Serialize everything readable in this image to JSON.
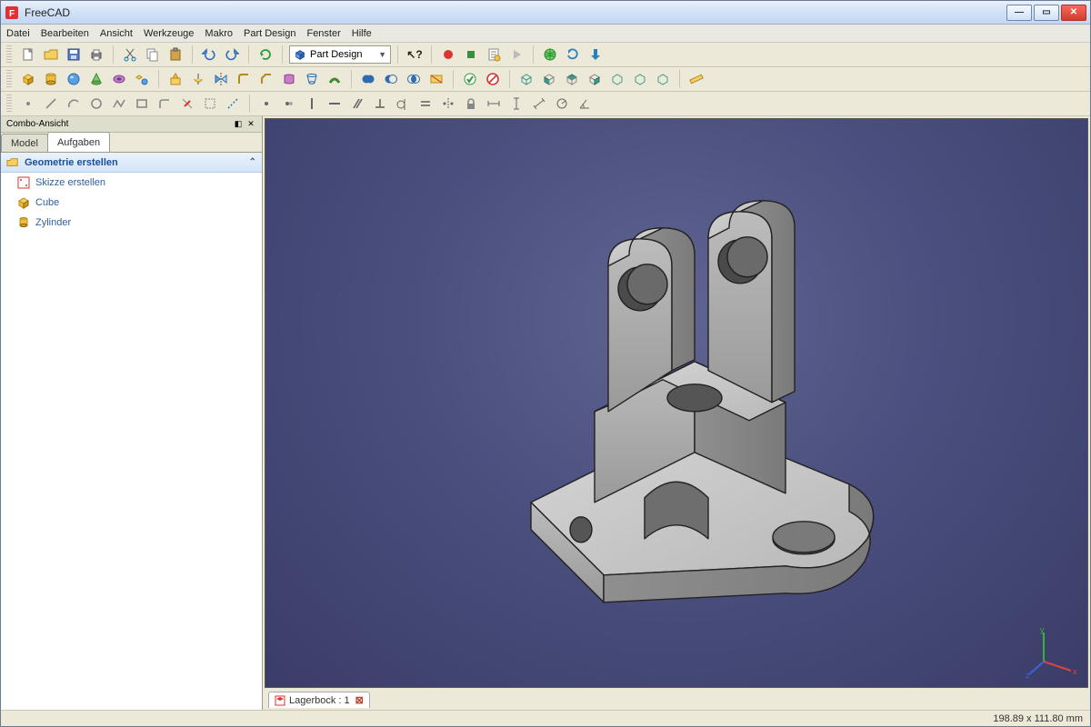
{
  "title": "FreeCAD",
  "menu": [
    "Datei",
    "Bearbeiten",
    "Ansicht",
    "Werkzeuge",
    "Makro",
    "Part Design",
    "Fenster",
    "Hilfe"
  ],
  "workbench": {
    "label": "Part Design"
  },
  "combo_panel": {
    "title": "Combo-Ansicht"
  },
  "tabs": {
    "model": "Model",
    "tasks": "Aufgaben",
    "active": "tasks"
  },
  "task_panel": {
    "header": "Geometrie erstellen",
    "items": [
      {
        "icon": "sketch",
        "label": "Skizze erstellen"
      },
      {
        "icon": "cube",
        "label": "Cube"
      },
      {
        "icon": "cylinder",
        "label": "Zylinder"
      }
    ]
  },
  "document_tab": {
    "label": "Lagerbock : 1"
  },
  "status": {
    "dims": "198.89 x 111.80 mm"
  },
  "axes": {
    "x": "x",
    "y": "y",
    "z": "z"
  }
}
